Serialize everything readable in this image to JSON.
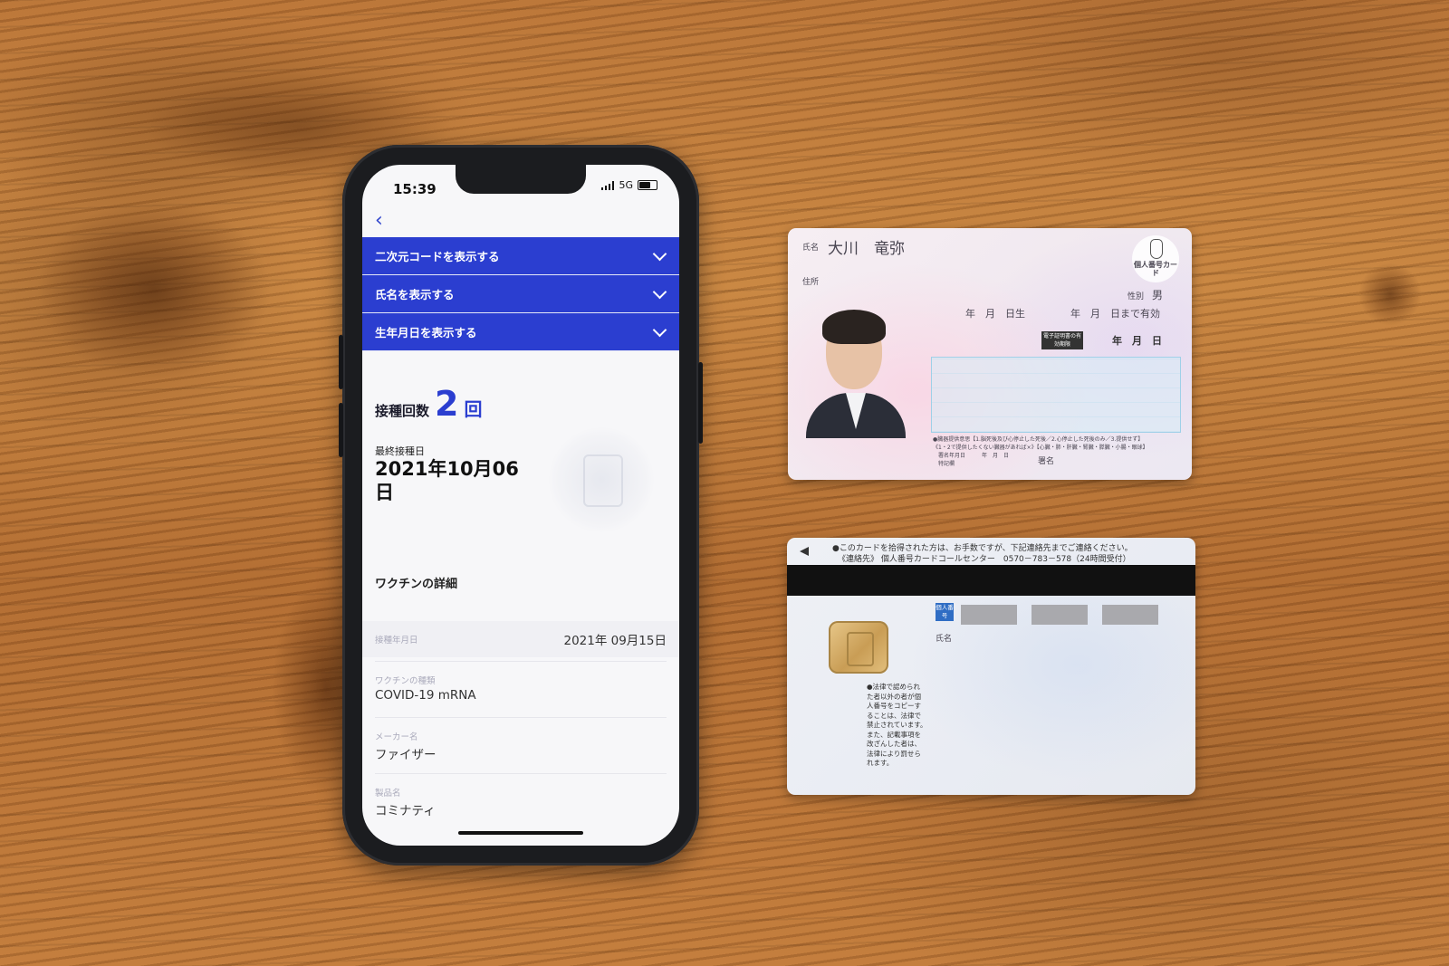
{
  "phone": {
    "status": {
      "time": "15:39",
      "network": "5G"
    },
    "accordion": [
      {
        "label": "二次元コードを表示する"
      },
      {
        "label": "氏名を表示する"
      },
      {
        "label": "生年月日を表示する"
      }
    ],
    "dose": {
      "label": "接種回数",
      "count": "2",
      "unit": "回"
    },
    "last_dose": {
      "label": "最終接種日",
      "date": "2021年10月06日"
    },
    "vaccine_section_title": "ワクチンの詳細",
    "details": [
      {
        "label": "接種年月日",
        "value": "2021年 09月15日"
      },
      {
        "label": "ワクチンの種類",
        "value": "COVID-19 mRNA"
      },
      {
        "label": "メーカー名",
        "value": "ファイザー"
      },
      {
        "label": "製品名",
        "value": "コミナティ"
      }
    ]
  },
  "id_card_front": {
    "name_label": "氏名",
    "name": "大川　竜弥",
    "address_label": "住所",
    "sex_label": "性別",
    "sex": "男",
    "birth_line": "年　月　日生",
    "valid_line": "年　月　日まで有効",
    "cert_badge": "電子証明書の有効期限",
    "cert_date": "年　月　日",
    "card_type": "個人番号カード",
    "donor_line_1": "●臓器提供意思【1.脳死後及び心停止した死後／2.心停止した死後のみ／3.提供せず】",
    "donor_line_2": "《1・2で提供したくない臓器があれば×》【心臓・肺・肝臓・腎臓・膵臓・小腸・眼球】",
    "donor_line_3": "署名年月日　　　年　月　日",
    "special_note_label": "特記欄",
    "signature_label": "署名"
  },
  "id_card_back": {
    "notice_line_1": "●このカードを拾得された方は、お手数ですが、下記連絡先までご連絡ください。",
    "notice_line_2": "《連絡先》 個人番号カードコールセンター　0570－783－578（24時間受付）",
    "number_badge": "個人番号",
    "name_label": "氏名",
    "legal_notice": [
      "●法律で認められ",
      "た者以外の者が個",
      "人番号をコピーす",
      "ることは、法律で",
      "禁止されています。",
      "また、記載事項を",
      "改ざんした者は、",
      "法律により罰せら",
      "れます。"
    ]
  },
  "colors": {
    "accent_blue": "#2b3ed0",
    "wood": "#c17a39",
    "phone_frame": "#1b1c1f"
  }
}
